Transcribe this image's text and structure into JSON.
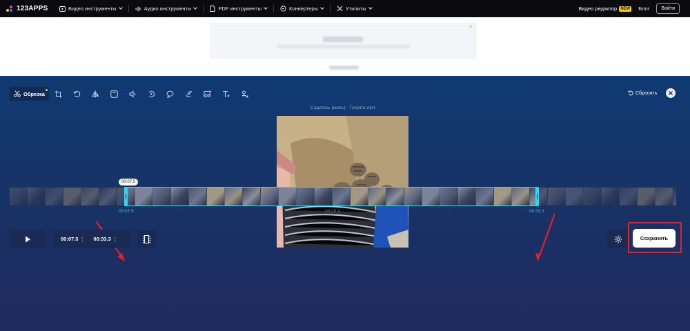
{
  "topbar": {
    "logo": "123APPS",
    "nav": [
      {
        "label": "Видео инструменты",
        "icon": "video-icon"
      },
      {
        "label": "Аудио инструменты",
        "icon": "audio-wave-icon"
      },
      {
        "label": "PDF инструменты",
        "icon": "pdf-icon"
      },
      {
        "label": "Конвертеры",
        "icon": "convert-icon"
      },
      {
        "label": "Утилиты",
        "icon": "tools-icon"
      }
    ],
    "video_editor": "Видео редактор",
    "new_badge": "NEW",
    "blog": "Блог",
    "login": "Войти"
  },
  "ad": {
    "close": "✕"
  },
  "toolbar": {
    "active_tool": "Обрезка",
    "tools": [
      "crop-icon",
      "rotate-icon",
      "flip-icon",
      "frame-icon",
      "volume-icon",
      "speed-icon",
      "loop-icon",
      "stabilize-icon",
      "image-icon",
      "text-icon",
      "remove-logo-icon"
    ],
    "reset": "Сбросить"
  },
  "video": {
    "filename": "Садитесь ржать) - Тигрята.mp4"
  },
  "timeline": {
    "tooltip": "00:07.5",
    "start_label": "00:07.5",
    "mid_label": "00:20.4",
    "end_label": "00:33.3",
    "selection_start_fraction": 0.174,
    "selection_end_fraction": 0.792
  },
  "controls": {
    "start_time": "00:07.5",
    "end_time": "00:33.3",
    "save": "Сохранить"
  },
  "colors": {
    "accent_cyan": "#36d4ef",
    "highlight_red": "#e4212b",
    "badge_yellow": "#ffd400"
  }
}
